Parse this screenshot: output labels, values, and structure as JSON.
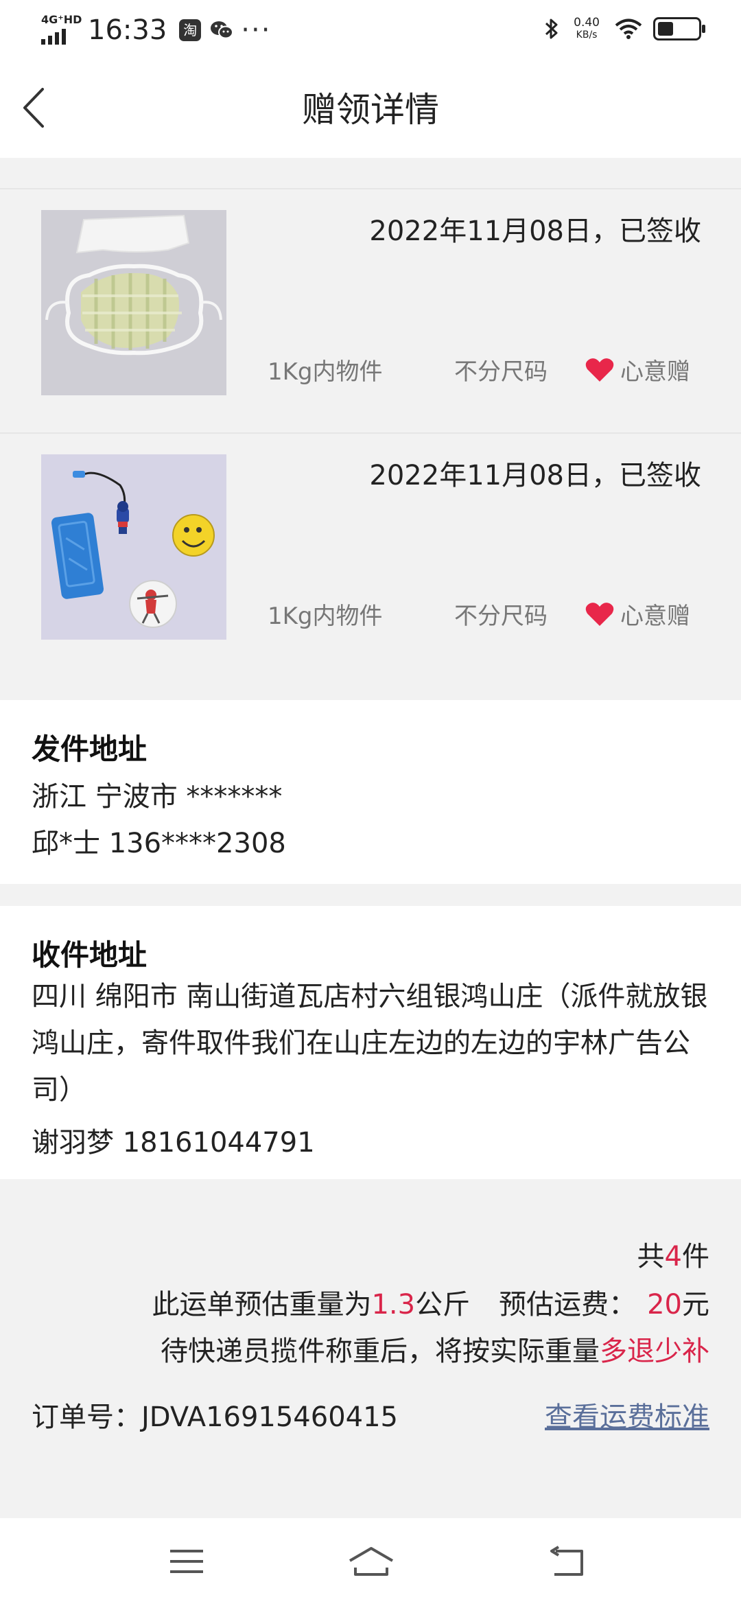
{
  "status_bar": {
    "network": "4G⁺HD",
    "time": "16:33",
    "app_icon_label": "淘",
    "more": "···",
    "speed_value": "0.40",
    "speed_unit": "KB/s",
    "battery_level": 0.35
  },
  "header": {
    "title": "赠领详情"
  },
  "items": [
    {
      "date_status": "2022年11月08日，已签收",
      "weight": "1Kg内物件",
      "size": "不分尺码",
      "gift_type": "心意赠"
    },
    {
      "date_status": "2022年11月08日，已签收",
      "weight": "1Kg内物件",
      "size": "不分尺码",
      "gift_type": "心意赠"
    }
  ],
  "sender": {
    "title": "发件地址",
    "region": "浙江 宁波市 *******",
    "contact": "邱*士 136****2308"
  },
  "receiver": {
    "title": "收件地址",
    "address": "四川 绵阳市 南山街道瓦店村六组银鸿山庄（派件就放银鸿山庄，寄件取件我们在山庄左边的左边的宇林广告公司）",
    "contact": "谢羽梦 18161044791"
  },
  "summary": {
    "count_prefix": "共",
    "count": "4",
    "count_suffix": "件",
    "weight_prefix": "此运单预估重量为",
    "weight_value": "1.3",
    "weight_unit": "公斤",
    "fee_label": "预估运费：",
    "fee_value": "20",
    "fee_unit": "元",
    "note_prefix": "待快递员揽件称重后，将按实际重量",
    "note_highlight": "多退少补",
    "order_label": "订单号：",
    "order_number": "JDVA16915460415",
    "fee_standard_link": "查看运费标准"
  },
  "colors": {
    "accent_red": "#d9254a",
    "link_blue": "#5a6f9a",
    "heart_red": "#e8274a"
  }
}
